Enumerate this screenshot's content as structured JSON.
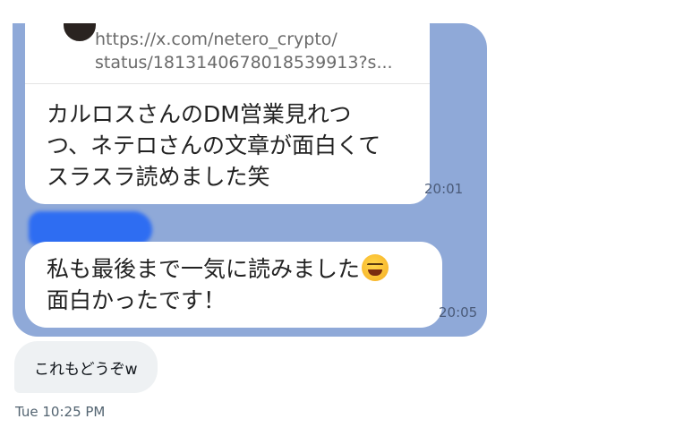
{
  "shared_image": {
    "link_preview": {
      "url": "https://x.com/netero_crypto/\nstatus/1813140678018539913?s..."
    },
    "message_1": {
      "text": "カルロスさんのDM営業見れつ\nつ、ネテロさんの文章が面白くて\nスラスラ読めました笑",
      "time": "20:01"
    },
    "message_2": {
      "text_line1": "私も最後まで一気に読みました",
      "emoji": "grinning-squinting-face",
      "text_line2": "面白かったです！",
      "time": "20:05"
    },
    "colors": {
      "background": "#8fa9d8",
      "bubble": "#ffffff",
      "redaction": "#2e6df2"
    }
  },
  "dm": {
    "message": "これもどうぞw",
    "timestamp": "Tue 10:25 PM"
  }
}
